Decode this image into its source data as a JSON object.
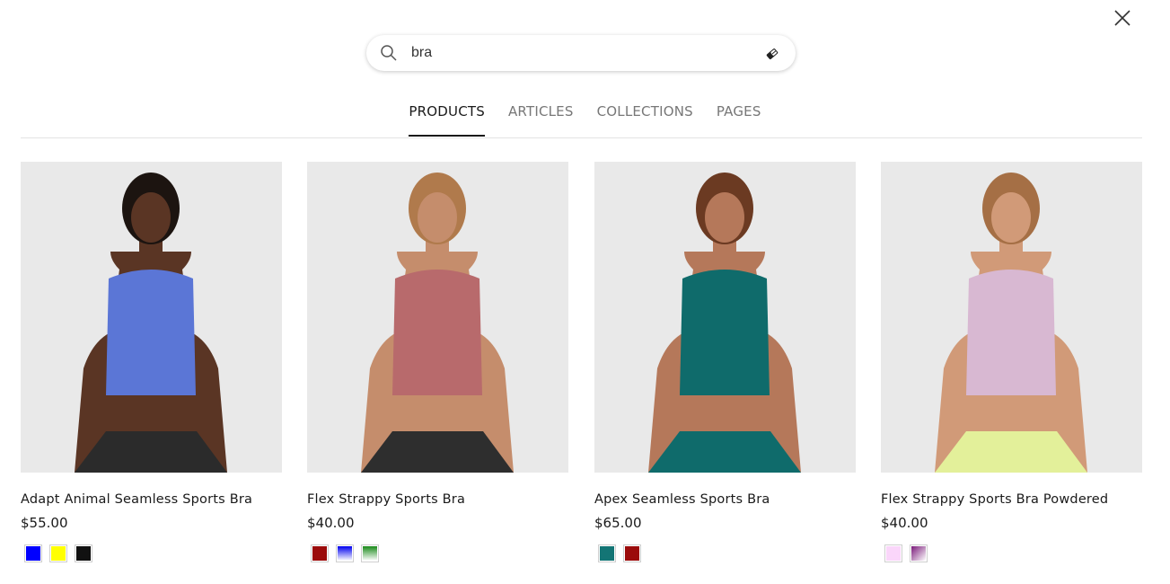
{
  "search": {
    "query": "bra"
  },
  "tabs": [
    {
      "label": "PRODUCTS",
      "active": true
    },
    {
      "label": "ARTICLES",
      "active": false
    },
    {
      "label": "COLLECTIONS",
      "active": false
    },
    {
      "label": "PAGES",
      "active": false
    }
  ],
  "products": [
    {
      "title": "Adapt Animal Seamless Sports Bra",
      "price": "$55.00",
      "top_color": "#5b76d6",
      "bottom_color": "#2b2b2b",
      "skin_color": "#5a3524",
      "hair_color": "#1c1410",
      "swatches": [
        "#0000ff",
        "#ffff00",
        "#111111"
      ]
    },
    {
      "title": "Flex Strappy Sports Bra",
      "price": "$40.00",
      "top_color": "#b86a6c",
      "bottom_color": "#2e2e2e",
      "skin_color": "#c58d6c",
      "hair_color": "#b07a4c",
      "swatches": [
        "#9b0b0b",
        "linear-gradient(#0000ee,#ffffff)",
        "linear-gradient(#1a8a1a,#ffffff)"
      ]
    },
    {
      "title": "Apex Seamless Sports Bra",
      "price": "$65.00",
      "top_color": "#0f6b6b",
      "bottom_color": "#0f6b6b",
      "skin_color": "#b5785a",
      "hair_color": "#6b3a22",
      "swatches": [
        "#137575",
        "#9b0b0b"
      ]
    },
    {
      "title": "Flex Strappy Sports Bra Powdered",
      "price": "$40.00",
      "top_color": "#d8b8d2",
      "bottom_color": "#e3f09a",
      "skin_color": "#d19a78",
      "hair_color": "#a56f45",
      "swatches": [
        "#fad6fa",
        "linear-gradient(135deg,#7a1a7a,#ffffff)"
      ]
    }
  ]
}
